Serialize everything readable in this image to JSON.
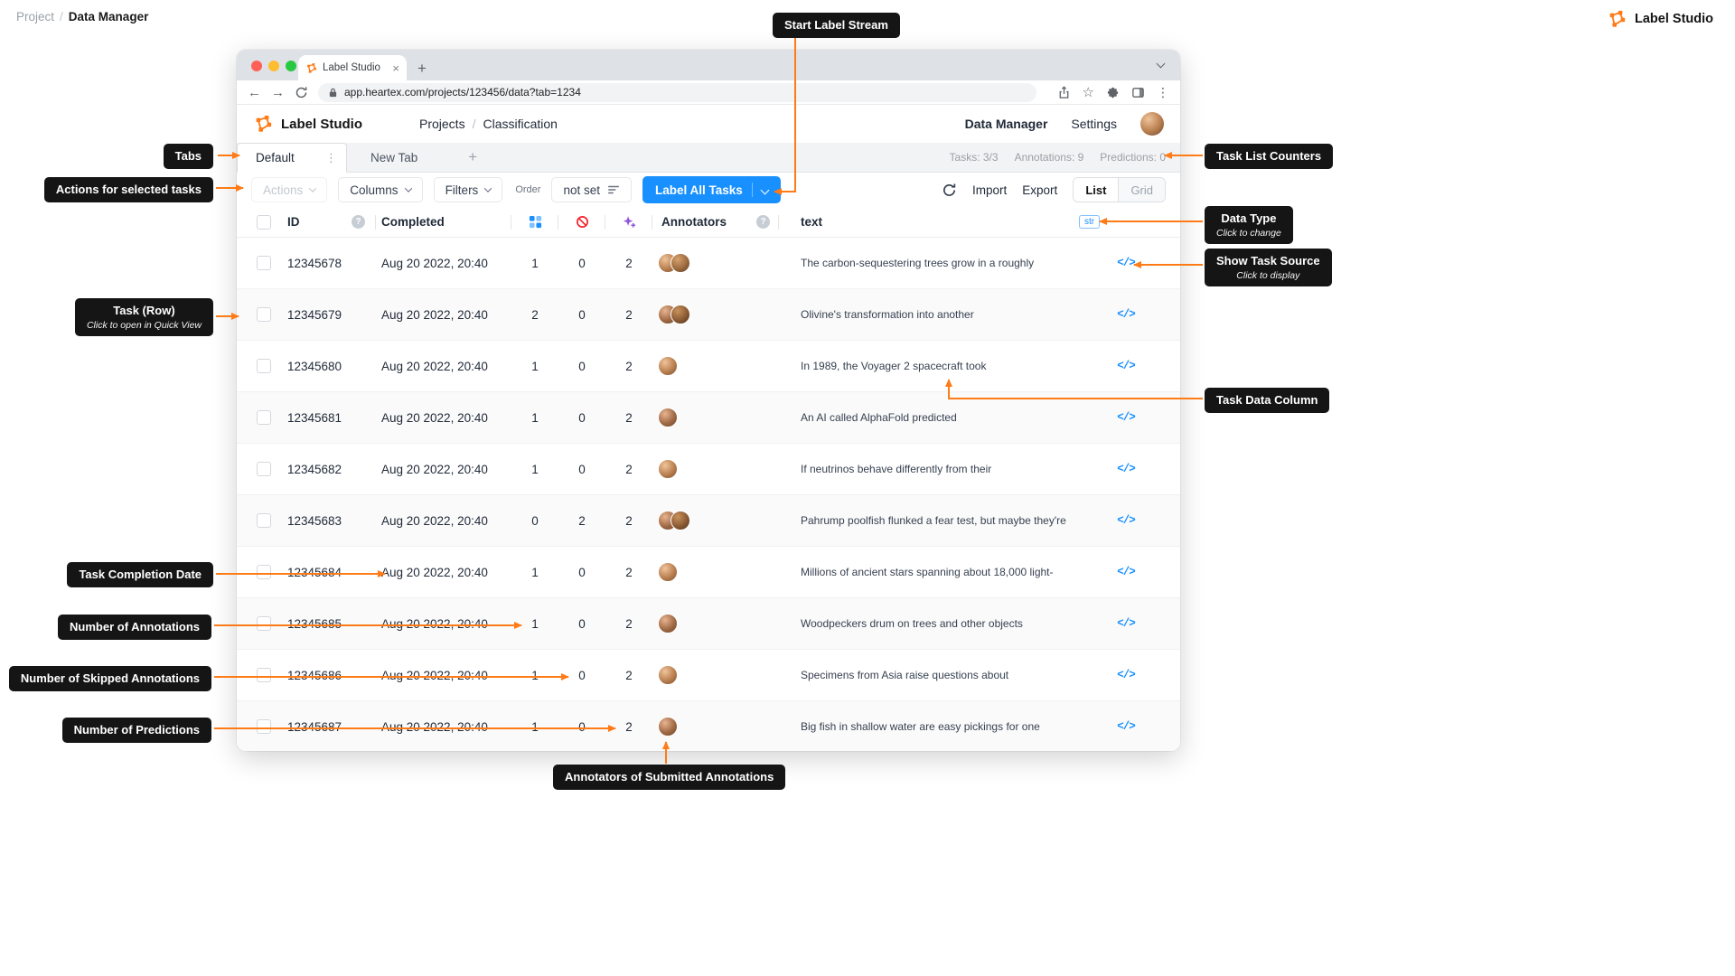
{
  "colors": {
    "accent_orange": "#FF7B17",
    "accent_blue": "#1890FF"
  },
  "icons": {
    "task_source": "</>",
    "help": "?",
    "close": "×",
    "plus": "+",
    "kebab": "⋮",
    "vdots": "⋮",
    "back": "←",
    "forward": "→",
    "star": "☆"
  },
  "page": {
    "breadcrumb_root": "Project",
    "breadcrumb_sep": "/",
    "breadcrumb_current": "Data Manager",
    "brand": "Label Studio"
  },
  "callouts": {
    "start_label_stream": "Start Label Stream",
    "tabs": "Tabs",
    "actions_selected": "Actions for selected tasks",
    "task_row_title": "Task (Row)",
    "task_row_sub": "Click to open in Quick View",
    "completion_date": "Task Completion Date",
    "num_annotations": "Number of Annotations",
    "num_skipped": "Number of Skipped Annotations",
    "num_predictions": "Number of Predictions",
    "task_list_counters": "Task List Counters",
    "data_type_title": "Data Type",
    "data_type_sub": "Click to change",
    "show_source_title": "Show Task Source",
    "show_source_sub": "Click to display",
    "task_data_column": "Task Data Column",
    "annotators_submitted": "Annotators of Submitted Annotations"
  },
  "browser": {
    "tab_title": "Label Studio",
    "url": "app.heartex.com/projects/123456/data?tab=1234"
  },
  "header": {
    "brand": "Label Studio",
    "breadcrumb_root": "Projects",
    "breadcrumb_sep": "/",
    "breadcrumb_current": "Classification",
    "nav_data_manager": "Data Manager",
    "nav_settings": "Settings"
  },
  "tabs": {
    "active": "Default",
    "new_tab": "New Tab",
    "counters": {
      "tasks": "Tasks: 3/3",
      "annotations": "Annotations: 9",
      "predictions": "Predictions: 0"
    }
  },
  "toolbar": {
    "actions": "Actions",
    "columns": "Columns",
    "filters": "Filters",
    "order_label": "Order",
    "order_value": "not set",
    "label_all_tasks": "Label All Tasks",
    "import": "Import",
    "export": "Export",
    "view_list": "List",
    "view_grid": "Grid"
  },
  "table": {
    "headers": {
      "id": "ID",
      "completed": "Completed",
      "annotators": "Annotators",
      "text": "text",
      "type_badge": "str"
    },
    "rows": [
      {
        "id": "12345678",
        "completed": "Aug 20 2022, 20:40",
        "annotations": "1",
        "skipped": "0",
        "predictions": "2",
        "annotators": 2,
        "text": "The carbon-sequestering trees grow in a roughly"
      },
      {
        "id": "12345679",
        "completed": "Aug 20 2022, 20:40",
        "annotations": "2",
        "skipped": "0",
        "predictions": "2",
        "annotators": 2,
        "text": "Olivine's transformation into another"
      },
      {
        "id": "12345680",
        "completed": "Aug 20 2022, 20:40",
        "annotations": "1",
        "skipped": "0",
        "predictions": "2",
        "annotators": 1,
        "text": "In 1989, the Voyager 2 spacecraft took"
      },
      {
        "id": "12345681",
        "completed": "Aug 20 2022, 20:40",
        "annotations": "1",
        "skipped": "0",
        "predictions": "2",
        "annotators": 1,
        "text": "An AI called AlphaFold predicted"
      },
      {
        "id": "12345682",
        "completed": "Aug 20 2022, 20:40",
        "annotations": "1",
        "skipped": "0",
        "predictions": "2",
        "annotators": 1,
        "text": "If neutrinos behave differently from their"
      },
      {
        "id": "12345683",
        "completed": "Aug 20 2022, 20:40",
        "annotations": "0",
        "skipped": "2",
        "predictions": "2",
        "annotators": 2,
        "text": "Pahrump poolfish flunked a fear test, but maybe they're"
      },
      {
        "id": "12345684",
        "completed": "Aug 20 2022, 20:40",
        "annotations": "1",
        "skipped": "0",
        "predictions": "2",
        "annotators": 1,
        "text": "Millions of ancient stars spanning about 18,000 light-"
      },
      {
        "id": "12345685",
        "completed": "Aug 20 2022, 20:40",
        "annotations": "1",
        "skipped": "0",
        "predictions": "2",
        "annotators": 1,
        "text": "Woodpeckers drum on trees and other objects"
      },
      {
        "id": "12345686",
        "completed": "Aug 20 2022, 20:40",
        "annotations": "1",
        "skipped": "0",
        "predictions": "2",
        "annotators": 1,
        "text": "Specimens from Asia raise questions about"
      },
      {
        "id": "12345687",
        "completed": "Aug 20 2022, 20:40",
        "annotations": "1",
        "skipped": "0",
        "predictions": "2",
        "annotators": 1,
        "text": "Big fish in shallow water are easy pickings for one"
      }
    ]
  }
}
